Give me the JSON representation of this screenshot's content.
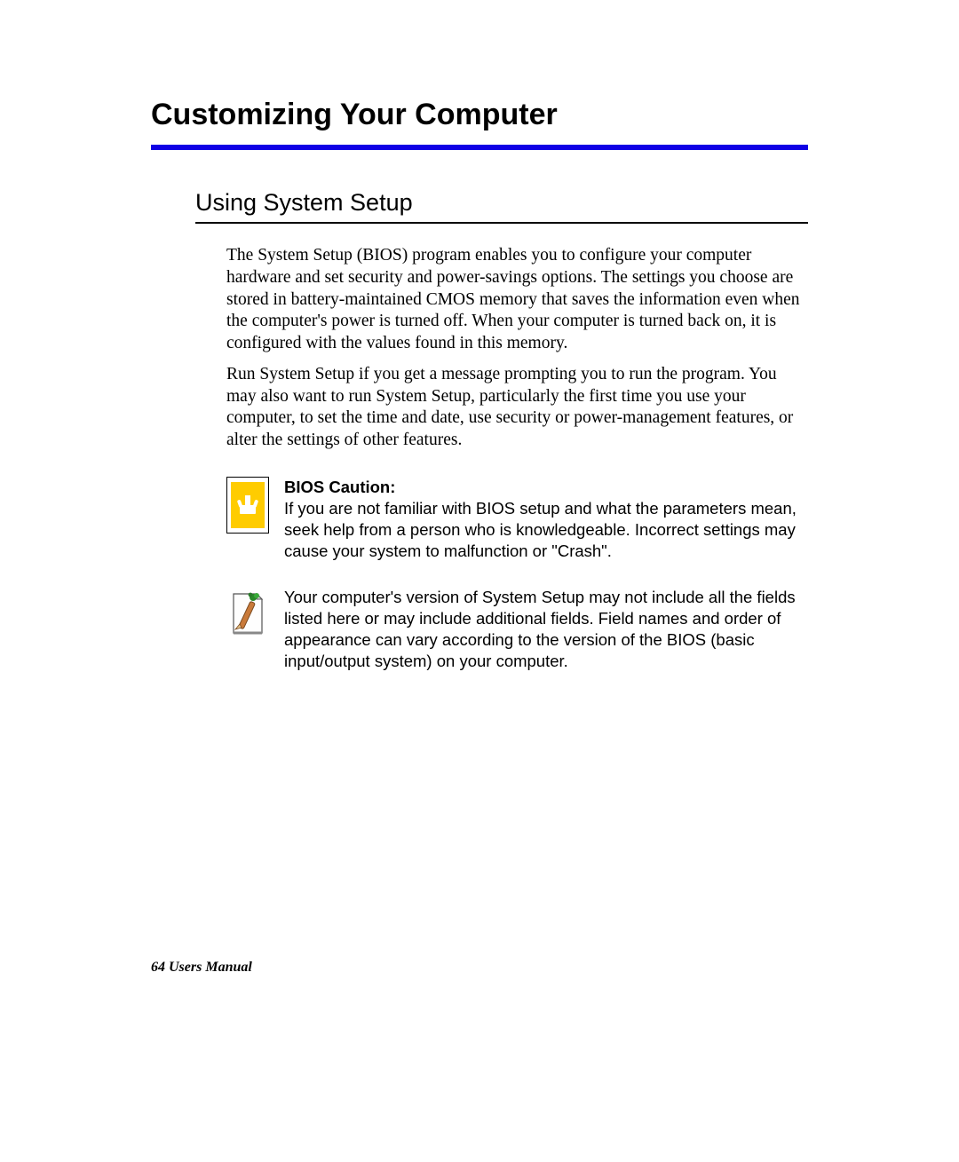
{
  "chapter_title": "Customizing Your Computer",
  "section_title": "Using System Setup",
  "para1": "The System Setup (BIOS) program enables you to configure your computer hardware and set security and power-savings options. The settings you choose are stored in battery-maintained CMOS memory that saves the information even when the computer's power is turned off. When your computer is turned back on, it is configured with the values found in this memory.",
  "para2": "Run System Setup if you get a message prompting you to run the program. You may also want to run System Setup, particularly the first time you use your computer, to set the time and date, use security or power-management features, or alter the settings of other features.",
  "caution": {
    "heading": "BIOS Caution:",
    "text": "If you are not familiar with BIOS setup and what the parameters mean, seek help from a person who is knowledgeable. Incorrect settings may cause your system to malfunction or \"Crash\"."
  },
  "note": {
    "text": "Your computer's version of System Setup may not include all the fields listed here or may include additional fields. Field names and order of appearance can vary according to the version of the BIOS (basic input/output system) on your computer."
  },
  "footer": "64  Users Manual"
}
